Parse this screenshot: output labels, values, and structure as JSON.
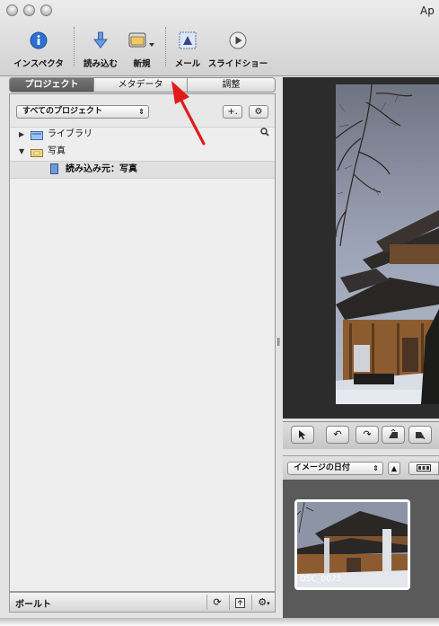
{
  "window": {
    "title": "Ap"
  },
  "toolbar": {
    "inspector_label": "インスペクタ",
    "import_label": "読み込む",
    "new_label": "新規",
    "mail_label": "メール",
    "slideshow_label": "スライドショー"
  },
  "tabs": [
    {
      "label": "プロジェクト",
      "active": true
    },
    {
      "label": "メタデータ",
      "active": false
    },
    {
      "label": "調整",
      "active": false
    }
  ],
  "projects": {
    "filter_value": "すべてのプロジェクト",
    "add_button_label": "+.",
    "action_button_label": "⚙"
  },
  "tree": [
    {
      "label": "ライブラリ",
      "icon": "library-folder-icon"
    },
    {
      "label": "写真",
      "icon": "project-folder-icon"
    },
    {
      "label": "読み込み元：写真",
      "icon": "album-icon"
    }
  ],
  "bottom_bar": {
    "label": "ボールト"
  },
  "browser": {
    "sort_value": "イメージの日付",
    "thumbnail_caption": "DSC_0075"
  },
  "colors": {
    "annotation_arrow": "#e41b1b",
    "active_tab": "#5f5f5f",
    "viewer_background": "#2c2c2c",
    "browser_background": "#5a5a5a",
    "accent_blue": "#2f6fd1"
  }
}
